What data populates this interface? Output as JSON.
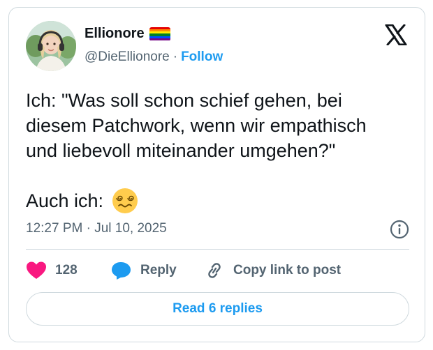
{
  "author": {
    "display_name": "Ellionore",
    "handle": "@DieEllionore",
    "separator": "·",
    "follow_label": "Follow",
    "badge_icon": "rainbow-flag-icon",
    "avatar_icon": "avatar-photo"
  },
  "brand": {
    "logo_icon": "x-logo-icon"
  },
  "tweet": {
    "text": "Ich: \"Was soll schon schief gehen, bei\ndiesem Patchwork, wenn wir empathisch\nund liebevoll miteinander umgehen?\"",
    "second_line": "Auch ich:",
    "emoji_icon": "dizzy-face-emoji",
    "timestamp": "12:27 PM · Jul 10, 2025"
  },
  "actions": {
    "like_count": "128",
    "reply_label": "Reply",
    "copy_label": "Copy link to post"
  },
  "read_replies_label": "Read 6 replies",
  "colors": {
    "accent": "#1d9bf0",
    "heart": "#f91880",
    "text": "#0f1419",
    "secondary": "#536471",
    "border": "#cfd9de"
  }
}
